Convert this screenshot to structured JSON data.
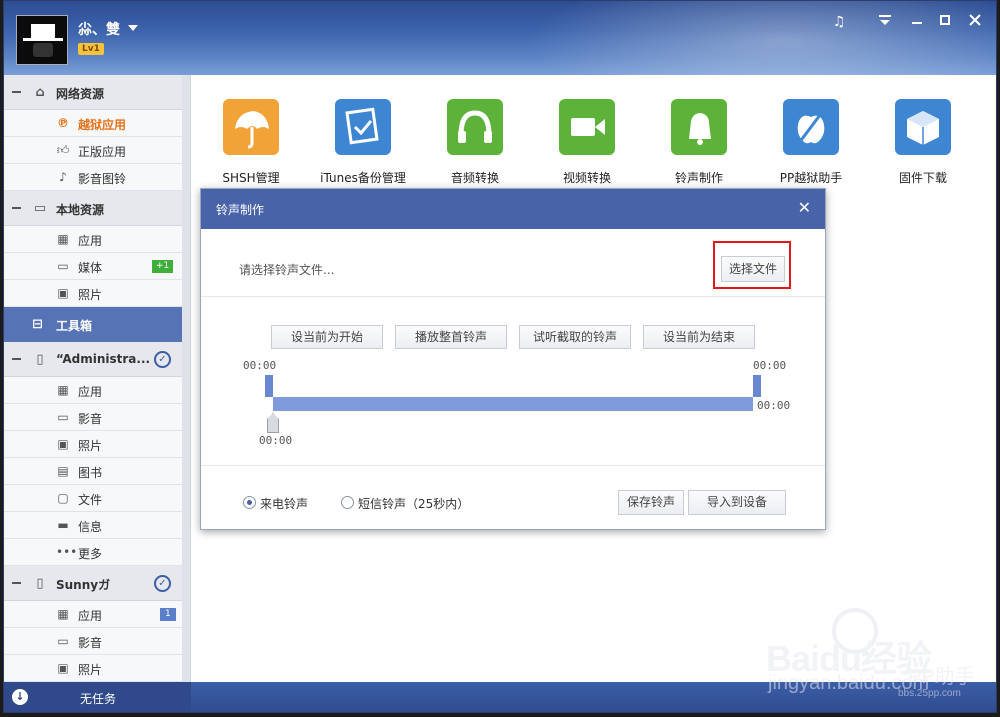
{
  "header": {
    "username": "尛、雙",
    "level": "Lv1",
    "window_controls": [
      "music-icon",
      "menu-icon",
      "minimize-icon",
      "close-icon"
    ]
  },
  "sidebar": {
    "sections": [
      {
        "title": "网络资源",
        "icon": "home-icon",
        "items": [
          {
            "label": "越狱应用",
            "icon": "pp-icon",
            "active": true
          },
          {
            "label": "正版应用",
            "icon": "thumbs-up-icon"
          },
          {
            "label": "影音图铃",
            "icon": "music-note-icon"
          }
        ]
      },
      {
        "title": "本地资源",
        "icon": "monitor-icon",
        "items": [
          {
            "label": "应用",
            "icon": "grid-icon"
          },
          {
            "label": "媒体",
            "icon": "video-icon",
            "badge": "+1"
          },
          {
            "label": "照片",
            "icon": "photo-icon"
          }
        ]
      }
    ],
    "toolbox": {
      "label": "工具箱",
      "icon": "toolbox-icon"
    },
    "devices": [
      {
        "title": "“Administra...",
        "items": [
          {
            "label": "应用",
            "icon": "grid-icon"
          },
          {
            "label": "影音",
            "icon": "video-icon"
          },
          {
            "label": "照片",
            "icon": "photo-icon"
          },
          {
            "label": "图书",
            "icon": "book-icon"
          },
          {
            "label": "文件",
            "icon": "file-icon"
          },
          {
            "label": "信息",
            "icon": "message-icon"
          },
          {
            "label": "更多",
            "icon": "more-icon"
          }
        ]
      },
      {
        "title": "Sunnyガ",
        "items": [
          {
            "label": "应用",
            "icon": "grid-icon",
            "badge": "1"
          },
          {
            "label": "影音",
            "icon": "video-icon"
          },
          {
            "label": "照片",
            "icon": "photo-icon"
          }
        ]
      }
    ]
  },
  "footer": {
    "status": "无任务"
  },
  "tools": [
    {
      "label": "SHSH管理",
      "icon": "umbrella-icon",
      "color": "#f2a338"
    },
    {
      "label": "iTunes备份管理",
      "icon": "backup-note-icon",
      "color": "#3f86d2"
    },
    {
      "label": "音频转换",
      "icon": "headphones-icon",
      "color": "#5db33a"
    },
    {
      "label": "视频转换",
      "icon": "camera-icon",
      "color": "#5db33a"
    },
    {
      "label": "铃声制作",
      "icon": "bell-icon",
      "color": "#5db33a"
    },
    {
      "label": "PP越狱助手",
      "icon": "zipper-apple-icon",
      "color": "#3f86d2"
    },
    {
      "label": "固件下载",
      "icon": "box-icon",
      "color": "#3f86d2"
    }
  ],
  "dialog": {
    "title": "铃声制作",
    "prompt": "请选择铃声文件...",
    "choose_file": "选择文件",
    "controls": [
      "设当前为开始",
      "播放整首铃声",
      "试听截取的铃声",
      "设当前为结束"
    ],
    "time_start": "00:00",
    "time_end": "00:00",
    "time_end_total": "00:00",
    "time_cursor": "00:00",
    "radio_call": "来电铃声",
    "radio_sms": "短信铃声（25秒内）",
    "selected_radio": "call",
    "save": "保存铃声",
    "import": "导入到设备"
  },
  "watermark": {
    "brand": "Baidu经验",
    "site": "jingyan.baidu.com",
    "app": "PP助手",
    "url": "bbs.25pp.com"
  },
  "colors": {
    "accent": "#4963a9",
    "highlight": "#e01818",
    "active_item": "#e5731a"
  }
}
